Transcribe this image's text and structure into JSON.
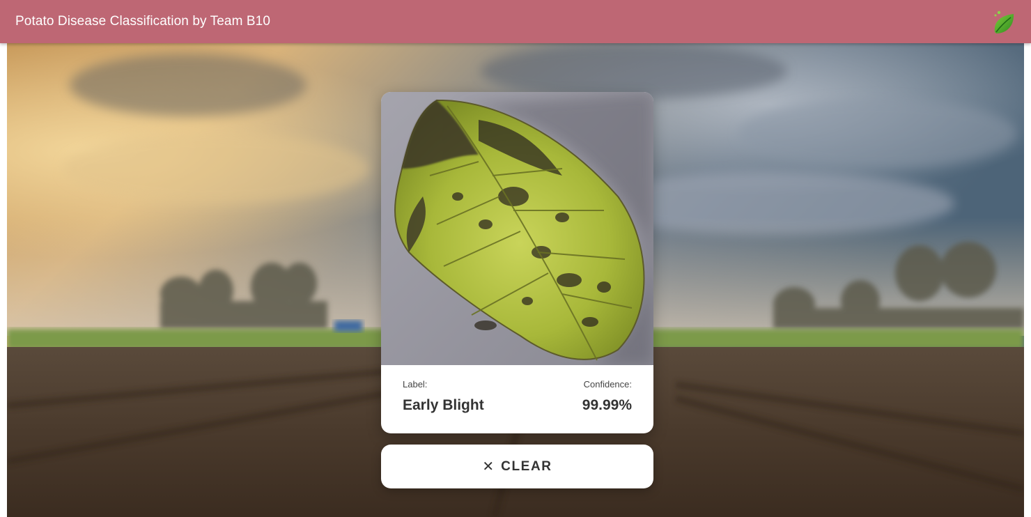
{
  "appbar": {
    "title": "Potato Disease Classification by Team B10",
    "logo_icon": "leaf-logo-icon",
    "color": "#be6774"
  },
  "background": {
    "description_icon": "farm-field-background"
  },
  "result": {
    "label_heading": "Label:",
    "label_value": "Early Blight",
    "confidence_heading": "Confidence:",
    "confidence_value": "99.99%"
  },
  "clear_button": {
    "icon": "close-icon",
    "label": "CLEAR"
  }
}
